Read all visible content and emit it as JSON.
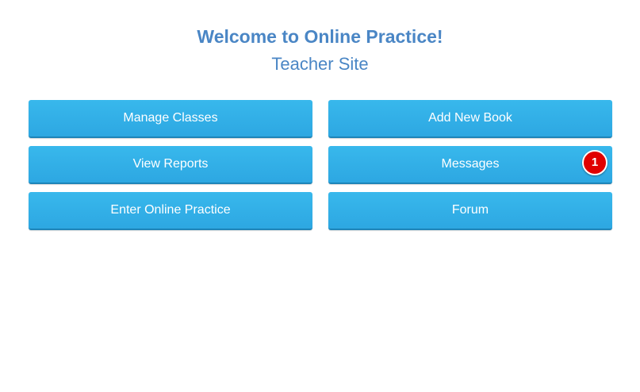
{
  "header": {
    "title": "Welcome to Online Practice!",
    "subtitle": "Teacher Site"
  },
  "buttons": {
    "manage_classes": "Manage Classes",
    "add_new_book": "Add New Book",
    "view_reports": "View Reports",
    "messages": "Messages",
    "messages_badge": "1",
    "enter_online_practice": "Enter Online Practice",
    "forum": "Forum"
  },
  "colors": {
    "title": "#4a86c5",
    "button": "#2da7e2",
    "badge": "#e00000"
  }
}
